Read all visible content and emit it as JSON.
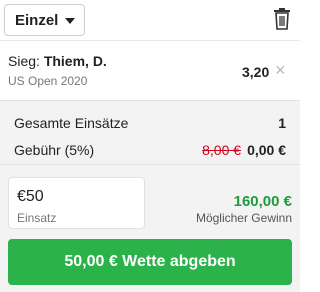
{
  "header": {
    "mode_select": "Einzel",
    "icons": [
      "chevron-down-icon",
      "trash-icon"
    ]
  },
  "bet": {
    "selection_prefix": "Sieg:",
    "selection_name": "Thiem, D.",
    "event": "US Open 2020",
    "odds": "3,20",
    "remove_symbol": "×"
  },
  "summary": {
    "total_label": "Gesamte Einsätze",
    "total_value": "1",
    "fee_label": "Gebühr (5%)",
    "fee_old": "8,00 €",
    "fee_new": "0,00 €"
  },
  "stake": {
    "value": "€50",
    "label": "Einsatz"
  },
  "winnings": {
    "amount": "160,00 €",
    "label": "Möglicher Gewinn"
  },
  "submit": {
    "label": "50,00 € Wette abgeben"
  },
  "colors": {
    "accent_green": "#2cb24a",
    "win_green": "#1e9c3c",
    "strike_red": "#d0021b"
  }
}
